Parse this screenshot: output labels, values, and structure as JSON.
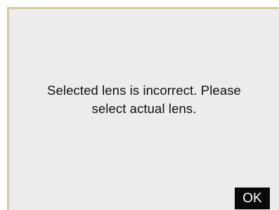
{
  "dialog": {
    "message_line1": "Selected lens is incorrect. Please",
    "message_line2": "select actual lens.",
    "ok_label": "OK"
  },
  "colors": {
    "dialog_background": "#ececec",
    "border_accent": "#d9c89a",
    "button_background": "#0a0a0a",
    "button_text": "#ffffff",
    "text": "#111111"
  }
}
